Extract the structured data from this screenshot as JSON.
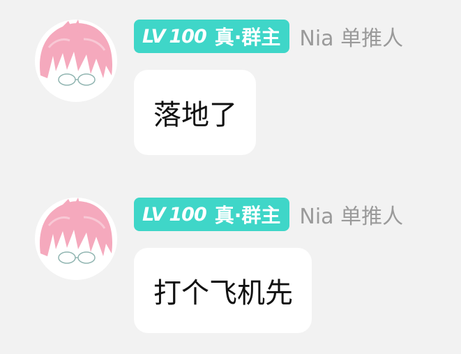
{
  "colors": {
    "background": "#f2f2f2",
    "badge": "#3fd6c8",
    "bubble": "#ffffff",
    "nickname": "#9a9a9a",
    "avatar_hair": "#f5a9bd"
  },
  "messages": [
    {
      "avatar_icon": "pink-hair-anime-avatar-icon",
      "badge": {
        "lv": "LV",
        "level": "100",
        "title": "真·群主"
      },
      "nickname": "Nia 单推人",
      "text": "落地了"
    },
    {
      "avatar_icon": "pink-hair-anime-avatar-icon",
      "badge": {
        "lv": "LV",
        "level": "100",
        "title": "真·群主"
      },
      "nickname": "Nia 单推人",
      "text": "打个飞机先"
    }
  ]
}
